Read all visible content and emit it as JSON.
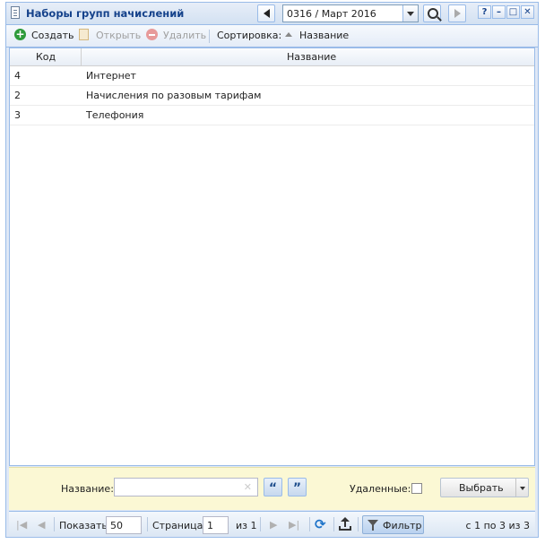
{
  "window": {
    "title": "Наборы групп начислений",
    "period_value": "0316 / Март 2016",
    "btn_help": "?"
  },
  "toolbar": {
    "create_label": "Создать",
    "open_label": "Открыть",
    "delete_label": "Удалить",
    "sort_label": "Сортировка:",
    "sort_field": "Название"
  },
  "grid": {
    "columns": [
      "Код",
      "Название"
    ],
    "rows": [
      {
        "code": "4",
        "name": "Интернет"
      },
      {
        "code": "2",
        "name": "Начисления по разовым тарифам"
      },
      {
        "code": "3",
        "name": "Телефония"
      }
    ]
  },
  "filter": {
    "name_label": "Название:",
    "name_value": "",
    "deleted_label": "Удаленные:",
    "select_button": "Выбрать"
  },
  "pager": {
    "show_label": "Показать",
    "page_size": "50",
    "page_label": "Страница",
    "page_value": "1",
    "of_label": "из 1",
    "filter_button": "Фильтр",
    "info": "с 1 по 3 из 3"
  },
  "colors": {
    "border": "#99bbe8",
    "title_text": "#15428b",
    "filter_bg": "#fbf8d4",
    "create_green": "#2e9b3b"
  }
}
